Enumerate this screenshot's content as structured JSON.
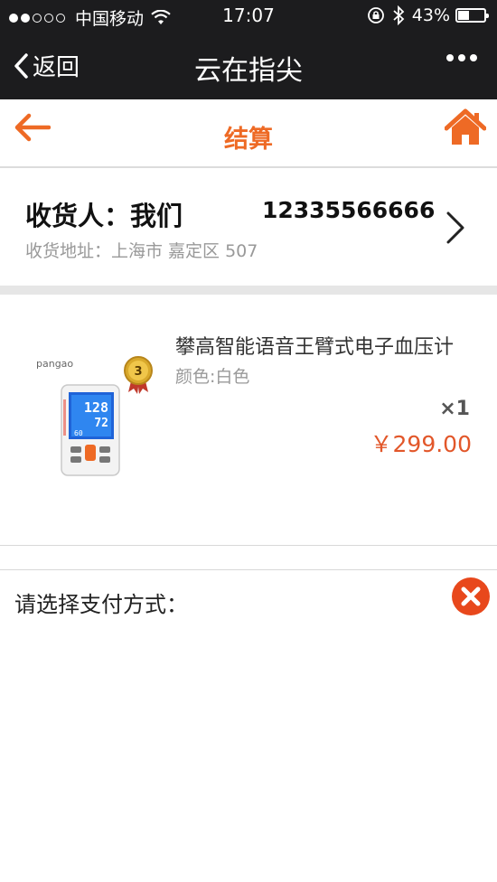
{
  "status_bar": {
    "carrier": "中国移动",
    "time": "17:07",
    "battery_text": "43%",
    "battery_level": 0.43
  },
  "nav": {
    "back_label": "返回",
    "title": "云在指尖",
    "more_icon": "more-dots-icon"
  },
  "header": {
    "title": "结算",
    "back_icon": "arrow-left-icon",
    "home_icon": "home-icon",
    "accent_color": "#ee6a25"
  },
  "address": {
    "name_label": "收货人：我们",
    "phone": "12335566666",
    "address_line": "收货地址：上海市 嘉定区 507"
  },
  "product": {
    "name": "攀高智能语音王臂式电子血压计",
    "attribute": "颜色:白色",
    "quantity": "×1",
    "price": "￥299.00",
    "brand_text": "pangao",
    "badge_text": "3",
    "screen_readings": [
      "128",
      "72",
      "60"
    ]
  },
  "payment": {
    "label": "请选择支付方式：",
    "close_icon": "close-circle-icon",
    "close_color": "#e8481c"
  }
}
